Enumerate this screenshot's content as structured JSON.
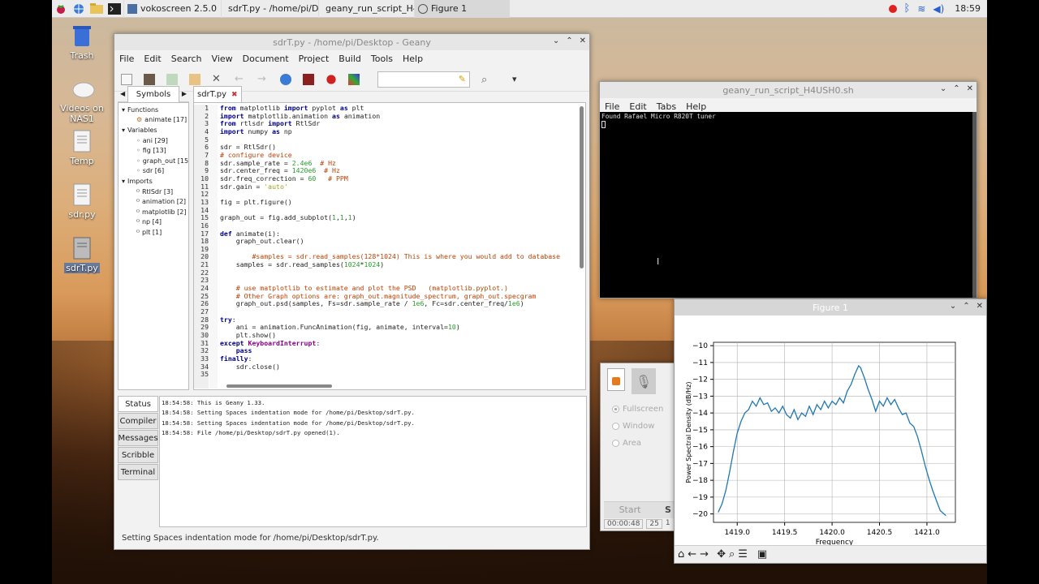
{
  "taskbar": {
    "tasks": [
      "vokoscreen 2.5.0",
      "sdrT.py - /home/pi/De...",
      "geany_run_script_H4...",
      "Figure 1"
    ],
    "clock": "18:59"
  },
  "desktop_icons": [
    "Trash",
    "Videos on NAS1",
    "Temp",
    "sdr.py",
    "sdrT.py"
  ],
  "geany": {
    "title": "sdrT.py - /home/pi/Desktop - Geany",
    "menu": [
      "File",
      "Edit",
      "Search",
      "View",
      "Document",
      "Project",
      "Build",
      "Tools",
      "Help"
    ],
    "sidebar_tab": "Symbols",
    "file_tab": "sdrT.py",
    "symbols": [
      {
        "label": "Functions",
        "indent": 0,
        "icon": "open"
      },
      {
        "label": "animate [17]",
        "indent": 1,
        "icon": "func"
      },
      {
        "label": "Variables",
        "indent": 0,
        "icon": "open"
      },
      {
        "label": "ani [29]",
        "indent": 1,
        "icon": "var"
      },
      {
        "label": "fig [13]",
        "indent": 1,
        "icon": "var"
      },
      {
        "label": "graph_out [15",
        "indent": 1,
        "icon": "var"
      },
      {
        "label": "sdr [6]",
        "indent": 1,
        "icon": "var"
      },
      {
        "label": "Imports",
        "indent": 0,
        "icon": "open"
      },
      {
        "label": "RtlSdr [3]",
        "indent": 1,
        "icon": "imp"
      },
      {
        "label": "animation [2]",
        "indent": 1,
        "icon": "imp"
      },
      {
        "label": "matplotlib [2]",
        "indent": 1,
        "icon": "imp"
      },
      {
        "label": "np [4]",
        "indent": 1,
        "icon": "imp"
      },
      {
        "label": "plt [1]",
        "indent": 1,
        "icon": "imp"
      }
    ],
    "code_lines": [
      "from matplotlib import pyplot as plt",
      "import matplotlib.animation as animation",
      "from rtlsdr import RtlSdr",
      "import numpy as np",
      "",
      "sdr = RtlSdr()",
      "# configure device",
      "sdr.sample_rate = 2.4e6  # Hz",
      "sdr.center_freq = 1420e6  # Hz",
      "sdr.freq_correction = 60   # PPM",
      "sdr.gain = 'auto'",
      "",
      "fig = plt.figure()",
      "",
      "graph_out = fig.add_subplot(1,1,1)",
      "",
      "def animate(i):",
      "    graph_out.clear()",
      "",
      "        #samples = sdr.read_samples(128*1024) This is where you would add to database",
      "    samples = sdr.read_samples(1024*1024)",
      "",
      "",
      "    # use matplotlib to estimate and plot the PSD   (matplotlib.pyplot.)",
      "    # Other Graph options are: graph_out.magnitude_spectrum, graph_out.specgram",
      "    graph_out.psd(samples, Fs=sdr.sample_rate / 1e6, Fc=sdr.center_freq/1e6)",
      "",
      "try:",
      "    ani = animation.FuncAnimation(fig, animate, interval=10)",
      "    plt.show()",
      "except KeyboardInterrupt:",
      "    pass",
      "finally:",
      "    sdr.close()",
      ""
    ],
    "msg_tabs": [
      "Status",
      "Compiler",
      "Messages",
      "Scribble",
      "Terminal"
    ],
    "messages": [
      "18:54:58: This is Geany 1.33.",
      "18:54:58: Setting Spaces indentation mode for /home/pi/Desktop/sdrT.py.",
      "18:54:58: Setting Spaces indentation mode for /home/pi/Desktop/sdrT.py.",
      "18:54:58: File /home/pi/Desktop/sdrT.py opened(1)."
    ],
    "statusbar": "Setting Spaces indentation mode for /home/pi/Desktop/sdrT.py."
  },
  "terminal": {
    "title": "geany_run_script_H4USH0.sh",
    "menu": [
      "File",
      "Edit",
      "Tabs",
      "Help"
    ],
    "output": "Found Rafael Micro R820T tuner"
  },
  "vokoscreen": {
    "options": [
      "Fullscreen",
      "Window",
      "Area"
    ],
    "start_label": "Start",
    "stop_label": "S",
    "time": "00:00:48",
    "fps": "25",
    "extra": "1"
  },
  "figure": {
    "title": "Figure 1",
    "toolbar_icons": [
      "home-icon",
      "back-icon",
      "forward-icon",
      "pan-icon",
      "zoom-icon",
      "configure-icon",
      "save-icon"
    ]
  },
  "chart_data": {
    "type": "line",
    "title": "",
    "xlabel": "Frequency",
    "ylabel": "Power Spectral Density (dB/Hz)",
    "xlim": [
      1418.75,
      1421.3
    ],
    "ylim": [
      -20.5,
      -9.8
    ],
    "xticks": [
      1419.0,
      1419.5,
      1420.0,
      1420.5,
      1421.0
    ],
    "yticks": [
      -10,
      -11,
      -12,
      -13,
      -14,
      -15,
      -16,
      -17,
      -18,
      -19,
      -20
    ],
    "grid": true,
    "color": "#1f77b4",
    "x": [
      1418.8,
      1418.84,
      1418.88,
      1418.92,
      1418.96,
      1419.0,
      1419.04,
      1419.08,
      1419.12,
      1419.16,
      1419.2,
      1419.24,
      1419.28,
      1419.32,
      1419.36,
      1419.4,
      1419.44,
      1419.48,
      1419.52,
      1419.56,
      1419.6,
      1419.64,
      1419.68,
      1419.72,
      1419.76,
      1419.8,
      1419.84,
      1419.88,
      1419.92,
      1419.96,
      1420.0,
      1420.04,
      1420.08,
      1420.12,
      1420.16,
      1420.2,
      1420.24,
      1420.28,
      1420.3,
      1420.34,
      1420.38,
      1420.42,
      1420.46,
      1420.5,
      1420.54,
      1420.58,
      1420.62,
      1420.66,
      1420.7,
      1420.74,
      1420.78,
      1420.82,
      1420.86,
      1420.9,
      1420.94,
      1420.98,
      1421.02,
      1421.06,
      1421.1,
      1421.14,
      1421.2
    ],
    "y": [
      -19.9,
      -19.4,
      -18.6,
      -17.5,
      -16.3,
      -15.2,
      -14.5,
      -14.0,
      -13.8,
      -13.3,
      -13.6,
      -13.1,
      -13.5,
      -13.4,
      -13.9,
      -13.7,
      -14.0,
      -13.6,
      -14.1,
      -14.3,
      -13.8,
      -14.4,
      -14.0,
      -14.2,
      -13.6,
      -14.1,
      -13.5,
      -13.8,
      -13.3,
      -13.7,
      -13.3,
      -13.5,
      -13.1,
      -13.4,
      -12.7,
      -12.3,
      -11.7,
      -11.2,
      -11.3,
      -11.9,
      -12.6,
      -13.2,
      -13.9,
      -13.3,
      -13.6,
      -13.1,
      -13.5,
      -13.2,
      -13.7,
      -14.1,
      -14.0,
      -14.6,
      -14.8,
      -15.4,
      -16.2,
      -17.1,
      -17.9,
      -18.6,
      -19.2,
      -19.8,
      -20.1
    ]
  }
}
